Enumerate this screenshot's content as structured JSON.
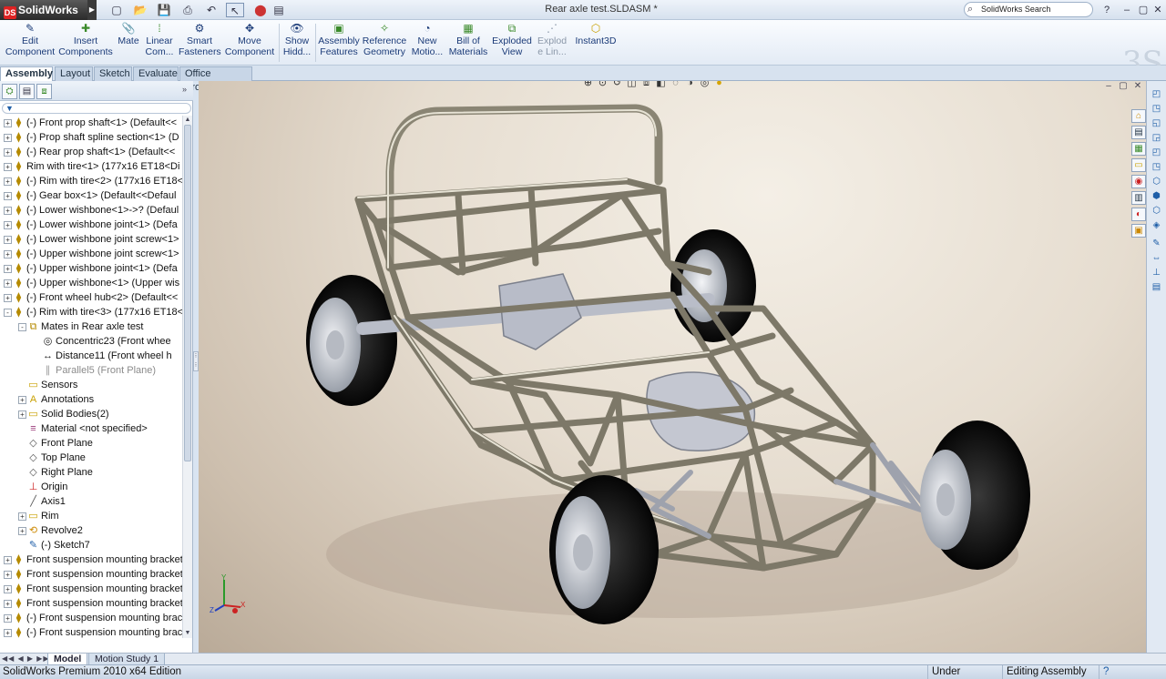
{
  "app": {
    "name": "SolidWorks",
    "document_title": "Rear axle test.SLDASM *",
    "search_placeholder": "SolidWorks Search"
  },
  "command_manager": [
    {
      "label1": "Edit",
      "label2": "Component",
      "icon": "edit-component-icon",
      "disabled": true
    },
    {
      "label1": "Insert",
      "label2": "Components",
      "icon": "insert-components-icon"
    },
    {
      "label1": "Mate",
      "label2": "",
      "icon": "mate-icon"
    },
    {
      "label1": "Linear",
      "label2": "Com...",
      "icon": "linear-pattern-icon"
    },
    {
      "label1": "Smart",
      "label2": "Fasteners",
      "icon": "smart-fasteners-icon"
    },
    {
      "label1": "Move",
      "label2": "Component",
      "icon": "move-component-icon"
    },
    {
      "label1": "Show",
      "label2": "Hidd...",
      "icon": "show-hidden-icon"
    },
    {
      "label1": "Assembly",
      "label2": "Features",
      "icon": "assembly-features-icon"
    },
    {
      "label1": "Reference",
      "label2": "Geometry",
      "icon": "reference-geometry-icon"
    },
    {
      "label1": "New",
      "label2": "Motio...",
      "icon": "new-motion-study-icon"
    },
    {
      "label1": "Bill of",
      "label2": "Materials",
      "icon": "bill-of-materials-icon"
    },
    {
      "label1": "Exploded",
      "label2": "View",
      "icon": "exploded-view-icon"
    },
    {
      "label1": "Explod",
      "label2": "e Lin...",
      "icon": "explode-line-icon",
      "disabled": true
    },
    {
      "label1": "Instant3D",
      "label2": "",
      "icon": "instant3d-icon"
    }
  ],
  "tabs": [
    "Assembly",
    "Layout",
    "Sketch",
    "Evaluate",
    "Office Products"
  ],
  "active_tab": "Assembly",
  "tree": [
    {
      "text": "(-) Front prop shaft<1> (Default<<",
      "icon": "part-icon",
      "level": 0,
      "exp": "+"
    },
    {
      "text": "(-) Prop shaft spline section<1> (D",
      "icon": "part-icon",
      "level": 0,
      "exp": "+"
    },
    {
      "text": "(-) Rear prop shaft<1> (Default<<",
      "icon": "part-icon",
      "level": 0,
      "exp": "+"
    },
    {
      "text": "Rim with tire<1> (177x16 ET18<Di",
      "icon": "part-icon",
      "level": 0,
      "exp": "+"
    },
    {
      "text": "(-) Rim with tire<2> (177x16 ET18<",
      "icon": "part-icon",
      "level": 0,
      "exp": "+"
    },
    {
      "text": "(-) Gear box<1> (Default<<Defaul",
      "icon": "part-icon",
      "level": 0,
      "exp": "+"
    },
    {
      "text": "(-) Lower wishbone<1>->? (Defaul",
      "icon": "part-icon",
      "level": 0,
      "exp": "+"
    },
    {
      "text": "(-) Lower wishbone joint<1> (Defa",
      "icon": "part-icon",
      "level": 0,
      "exp": "+"
    },
    {
      "text": "(-) Lower wishbone joint screw<1>",
      "icon": "part-icon",
      "level": 0,
      "exp": "+"
    },
    {
      "text": "(-) Upper wishbone joint screw<1>",
      "icon": "part-icon",
      "level": 0,
      "exp": "+"
    },
    {
      "text": "(-) Upper wishbone joint<1> (Defa",
      "icon": "part-icon",
      "level": 0,
      "exp": "+"
    },
    {
      "text": "(-) Upper wishbone<1> (Upper wis",
      "icon": "part-icon",
      "level": 0,
      "exp": "+"
    },
    {
      "text": "(-) Front wheel hub<2> (Default<<",
      "icon": "part-icon",
      "level": 0,
      "exp": "+"
    },
    {
      "text": "(-) Rim with tire<3> (177x16 ET18<",
      "icon": "part-icon",
      "level": 0,
      "exp": "-"
    },
    {
      "text": "Mates in Rear axle test",
      "icon": "mates-folder-icon",
      "level": 1,
      "exp": "-"
    },
    {
      "text": "Concentric23 (Front whee",
      "icon": "concentric-mate-icon",
      "level": 2,
      "exp": ""
    },
    {
      "text": "Distance11 (Front wheel h",
      "icon": "distance-mate-icon",
      "level": 2,
      "exp": ""
    },
    {
      "text": "Parallel5 (Front Plane)",
      "icon": "parallel-mate-icon",
      "level": 2,
      "exp": "",
      "dim": true
    },
    {
      "text": "Sensors",
      "icon": "sensors-folder-icon",
      "level": 1,
      "exp": ""
    },
    {
      "text": "Annotations",
      "icon": "annotations-icon",
      "level": 1,
      "exp": "+"
    },
    {
      "text": "Solid Bodies(2)",
      "icon": "solid-bodies-folder-icon",
      "level": 1,
      "exp": "+"
    },
    {
      "text": "Material <not specified>",
      "icon": "material-icon",
      "level": 1,
      "exp": ""
    },
    {
      "text": "Front Plane",
      "icon": "plane-icon",
      "level": 1,
      "exp": ""
    },
    {
      "text": "Top Plane",
      "icon": "plane-icon",
      "level": 1,
      "exp": ""
    },
    {
      "text": "Right Plane",
      "icon": "plane-icon",
      "level": 1,
      "exp": ""
    },
    {
      "text": "Origin",
      "icon": "origin-icon",
      "level": 1,
      "exp": ""
    },
    {
      "text": "Axis1",
      "icon": "axis-icon",
      "level": 1,
      "exp": ""
    },
    {
      "text": "Rim",
      "icon": "folder-icon",
      "level": 1,
      "exp": "+"
    },
    {
      "text": "Revolve2",
      "icon": "revolve-icon",
      "level": 1,
      "exp": "+"
    },
    {
      "text": "(-) Sketch7",
      "icon": "sketch-icon",
      "level": 1,
      "exp": ""
    },
    {
      "text": "Front suspension mounting bracket",
      "icon": "part-icon",
      "level": 0,
      "exp": "+"
    },
    {
      "text": "Front suspension mounting bracket",
      "icon": "part-icon",
      "level": 0,
      "exp": "+"
    },
    {
      "text": "Front suspension mounting bracket",
      "icon": "part-icon",
      "level": 0,
      "exp": "+"
    },
    {
      "text": "Front suspension mounting bracket",
      "icon": "part-icon",
      "level": 0,
      "exp": "+"
    },
    {
      "text": "(-) Front suspension mounting brac",
      "icon": "part-icon",
      "level": 0,
      "exp": "+"
    },
    {
      "text": "(-) Front suspension mounting brac",
      "icon": "part-icon",
      "level": 0,
      "exp": "+"
    }
  ],
  "bottom_tabs": [
    "Model",
    "Motion Study 1"
  ],
  "active_bottom_tab": "Model",
  "status": {
    "product": "SolidWorks Premium 2010 x64 Edition",
    "definition": "Under Defined",
    "mode": "Editing Assembly"
  },
  "triad": {
    "x": "X",
    "y": "Y",
    "z": "Z"
  }
}
